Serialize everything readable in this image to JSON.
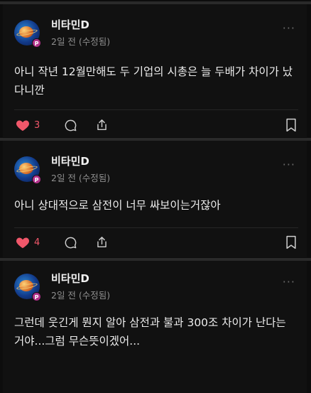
{
  "posts": [
    {
      "author": "비타민D",
      "meta": "2일 전 (수정됨)",
      "avatar_badge": "P",
      "text": "아니 작년 12월만해도 두 기업의 시총은 늘 두배가 차이가 났다니깐",
      "likes": "3",
      "more": "···"
    },
    {
      "author": "비타민D",
      "meta": "2일 전 (수정됨)",
      "avatar_badge": "P",
      "text": "아니 상대적으로 삼전이 너무 싸보이는거잖아",
      "likes": "4",
      "more": "···"
    },
    {
      "author": "비타민D",
      "meta": "2일 전 (수정됨)",
      "avatar_badge": "P",
      "text": "그런데 웃긴게 뭔지 알아 삼전과 불과 300조 차이가 난다는 거야...그럼 무슨뜻이겠어...",
      "more": "···"
    }
  ],
  "colors": {
    "like": "#f0576a",
    "background": "#0d0d0d",
    "card": "#111111"
  },
  "icons": [
    "heart-icon",
    "comment-icon",
    "share-icon",
    "bookmark-icon",
    "more-icon"
  ]
}
